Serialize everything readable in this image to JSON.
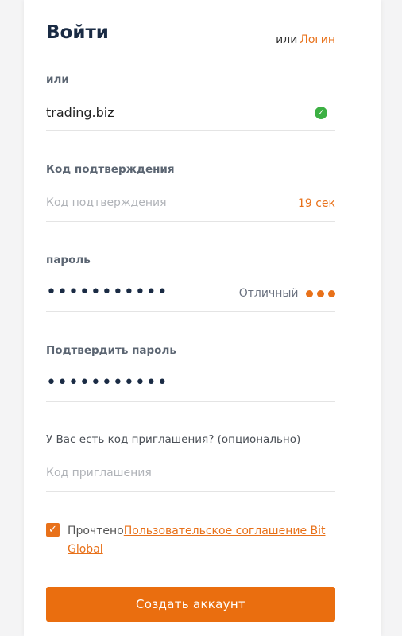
{
  "header": {
    "title": "Войти",
    "alt_prefix": "или",
    "alt_link": "Логин"
  },
  "email": {
    "label": "или",
    "value": "trading.biz",
    "status": "verified"
  },
  "code": {
    "label": "Код подтверждения",
    "placeholder": "Код подтверждения",
    "timer": "19 сек"
  },
  "password": {
    "label": "пароль",
    "masked": "•••••••••••",
    "strength_label": "Отличный",
    "strength_dots": 3
  },
  "confirm_password": {
    "label": "Подтвердить пароль",
    "masked": "•••••••••••"
  },
  "invite": {
    "label": "У Вас есть код приглашения? (опционально)",
    "placeholder": "Код приглашения"
  },
  "agreement": {
    "checked": true,
    "prefix": "Прочтено",
    "link": "Пользовательское соглашение Bit Global"
  },
  "submit": {
    "label": "Создать аккаунт"
  },
  "colors": {
    "accent": "#ea6e0f",
    "success": "#3cb043",
    "title": "#1a2b44"
  }
}
